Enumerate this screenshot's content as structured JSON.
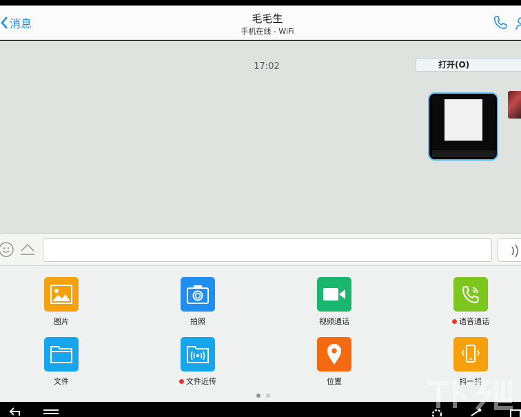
{
  "header": {
    "back_label": "消息",
    "title": "毛毛生",
    "subtitle": "手机在线 - WiFi"
  },
  "chat": {
    "timestamp": "17:02",
    "open_button_label": "打开(O)"
  },
  "input": {
    "placeholder": ""
  },
  "panel": {
    "tiles": [
      {
        "label": "图片",
        "icon": "image-icon",
        "color": "#f5a10c"
      },
      {
        "label": "拍照",
        "icon": "camera-icon",
        "color": "#1f8ef0"
      },
      {
        "label": "视频通话",
        "icon": "video-call-icon",
        "color": "#19b66d"
      },
      {
        "label": "语音通话",
        "icon": "voice-call-icon",
        "color": "#7cc61d",
        "badge": true
      },
      {
        "label": "文件",
        "icon": "folder-icon",
        "color": "#17a6ee"
      },
      {
        "label": "文件近传",
        "icon": "nearby-file-icon",
        "color": "#16a6ee",
        "badge": true
      },
      {
        "label": "位置",
        "icon": "location-icon",
        "color": "#f46a10"
      },
      {
        "label": "抖一抖",
        "icon": "shake-icon",
        "color": "#f5a10c"
      }
    ],
    "page_count": 2,
    "current_page": 1
  },
  "colors": {
    "accent": "#1a8ee6",
    "chat_bg": "#dfe3df",
    "panel_bg": "#eef1ef"
  }
}
